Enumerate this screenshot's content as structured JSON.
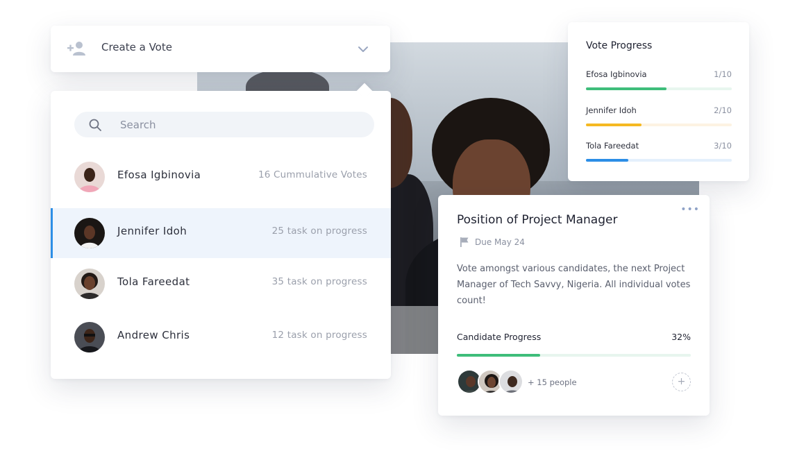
{
  "create_vote": {
    "label": "Create a Vote",
    "icon": "add-user-icon",
    "dropdown_icon": "chevron-down-icon"
  },
  "search": {
    "placeholder": "Search",
    "icon": "search-icon"
  },
  "candidates": [
    {
      "name": "Efosa Igbinovia",
      "meta": "16 Cummulative Votes",
      "selected": false
    },
    {
      "name": "Jennifer Idoh",
      "meta": "25 task on progress",
      "selected": true
    },
    {
      "name": "Tola Fareedat",
      "meta": "35 task on progress",
      "selected": false
    },
    {
      "name": "Andrew Chris",
      "meta": "12 task on progress",
      "selected": false
    }
  ],
  "vote_progress": {
    "title": "Vote Progress",
    "items": [
      {
        "name": "Efosa Igbinovia",
        "count": "1/10",
        "fraction": 0.55,
        "color": "#3ebd7a",
        "track": "#e8f6ef"
      },
      {
        "name": "Jennifer Idoh",
        "count": "2/10",
        "fraction": 0.38,
        "color": "#f5b922",
        "track": "#fdf3e2"
      },
      {
        "name": "Tola Fareedat",
        "count": "3/10",
        "fraction": 0.29,
        "color": "#2c8ee6",
        "track": "#e4f0fc"
      }
    ]
  },
  "position": {
    "title": "Position of Project Manager",
    "due": "Due May 24",
    "description": "Vote amongst various candidates, the next Project Manager of Tech Savvy, Nigeria. All individual votes count!",
    "progress_label": "Candidate Progress",
    "progress_value": "32%",
    "progress_fraction": 0.355,
    "people_more": "+ 15 people",
    "menu_icon": "more-dots-icon",
    "flag_icon": "flag-icon",
    "add_icon": "plus-icon"
  },
  "colors": {
    "accent": "#2c8ee6",
    "green": "#3ebd7a",
    "yellow": "#f5b922",
    "selected_row": "#eef4fc"
  }
}
